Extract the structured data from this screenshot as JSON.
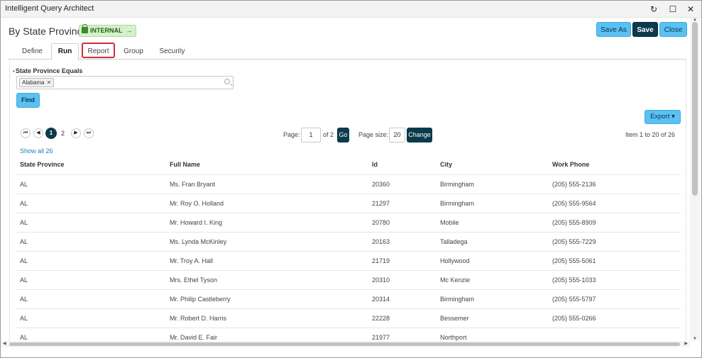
{
  "window": {
    "title": "Intelligent Query Architect",
    "refresh_glyph": "↻",
    "maximize_glyph": "☐",
    "close_glyph": "✕"
  },
  "header": {
    "title": "By State Province",
    "badge": "INTERNAL",
    "badge_arrow": "→",
    "badge_color": "#d4f2c9"
  },
  "toolbar": {
    "save_as": "Save As",
    "save": "Save",
    "close": "Close"
  },
  "tabs": [
    {
      "label": "Define"
    },
    {
      "label": "Run"
    },
    {
      "label": "Report"
    },
    {
      "label": "Group"
    },
    {
      "label": "Security"
    }
  ],
  "filter": {
    "label": "State Province Equals",
    "required_marker": "•",
    "tag": "Alabama",
    "tag_remove": "✕"
  },
  "find_label": "Find",
  "export_label": "Export ▾",
  "pagination": {
    "first": "⏮",
    "prev": "◀",
    "next": "▶",
    "last": "⏭",
    "current_page": "1",
    "other_page": "2",
    "page_label": "Page:",
    "page_value": "1",
    "of_label": "of 2",
    "go": "Go",
    "size_label": "Page size:",
    "size_value": "20",
    "change": "Change",
    "item_range": "Item 1 to 20 of 26"
  },
  "show_all": "Show all 26",
  "table": {
    "columns": [
      "State Province",
      "Full Name",
      "Id",
      "City",
      "Work Phone"
    ],
    "rows": [
      [
        "AL",
        "Ms. Fran Bryant",
        "20360",
        "Birmingham",
        "(205) 555-2136"
      ],
      [
        "AL",
        "Mr. Roy O. Holland",
        "21297",
        "Birmingham",
        "(205) 555-9564"
      ],
      [
        "AL",
        "Mr. Howard I. King",
        "20780",
        "Mobile",
        "(205) 555-8909"
      ],
      [
        "AL",
        "Ms. Lynda McKinley",
        "20163",
        "Talladega",
        "(205) 555-7229"
      ],
      [
        "AL",
        "Mr. Troy A. Hall",
        "21719",
        "Hollywood",
        "(205) 555-5061"
      ],
      [
        "AL",
        "Mrs. Ethel Tyson",
        "20310",
        "Mc Kenzie",
        "(205) 555-1033"
      ],
      [
        "AL",
        "Mr. Philip Castleberry",
        "20314",
        "Birmingham",
        "(205) 555-5797"
      ],
      [
        "AL",
        "Mr. Robert D. Harris",
        "22228",
        "Bessemer",
        "(205) 555-0266"
      ],
      [
        "AL",
        "Mr. David E. Fair",
        "21977",
        "Northport",
        ""
      ]
    ]
  },
  "colors": {
    "accent": "#5bc0f2",
    "dark": "#0b3a4b",
    "highlight": "#c9303a"
  }
}
